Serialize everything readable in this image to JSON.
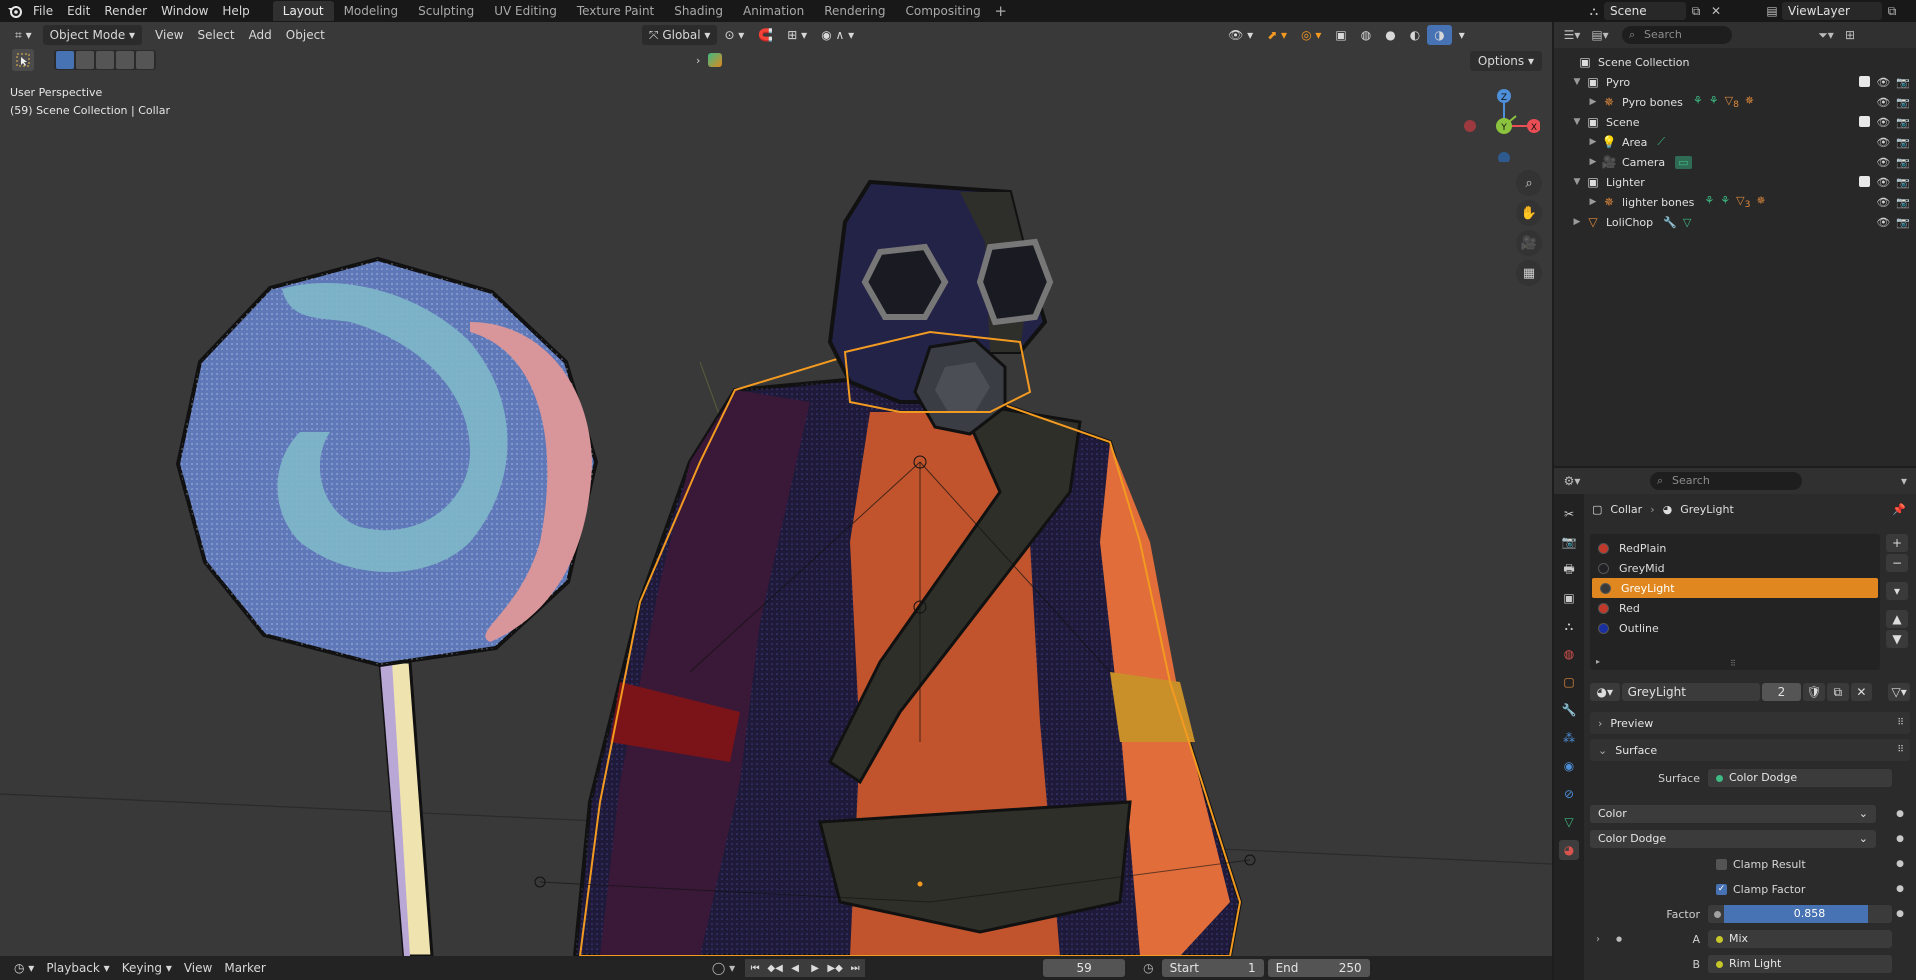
{
  "menu": {
    "items": [
      "File",
      "Edit",
      "Render",
      "Window",
      "Help"
    ],
    "workspaces": [
      "Layout",
      "Modeling",
      "Sculpting",
      "UV Editing",
      "Texture Paint",
      "Shading",
      "Animation",
      "Rendering",
      "Compositing"
    ],
    "active_workspace": "Layout",
    "scene_name": "Scene",
    "view_layer": "ViewLayer"
  },
  "viewport": {
    "mode": "Object Mode",
    "menus": [
      "View",
      "Select",
      "Add",
      "Object"
    ],
    "transform_orientation": "Global",
    "options_label": "Options",
    "info_line1": "User Perspective",
    "info_line2": "(59) Scene Collection | Collar",
    "gizmo": {
      "x": "X",
      "y": "Y",
      "z": "Z"
    },
    "colors": {
      "bg": "#393939",
      "x_axis": "#e94e55",
      "y_axis": "#8bc33f",
      "z_axis": "#4d8fd8",
      "selection": "#f39a21"
    }
  },
  "timeline": {
    "menus": [
      "Playback",
      "Keying",
      "View",
      "Marker"
    ],
    "current_frame": "59",
    "start_label": "Start",
    "start": "1",
    "end_label": "End",
    "end": "250"
  },
  "outliner": {
    "search_placeholder": "Search",
    "root": "Scene Collection",
    "rows": [
      {
        "label": "Pyro",
        "type": "collection"
      },
      {
        "label": "Pyro bones",
        "type": "armature"
      },
      {
        "label": "Scene",
        "type": "collection"
      },
      {
        "label": "Area",
        "type": "light"
      },
      {
        "label": "Camera",
        "type": "camera"
      },
      {
        "label": "Lighter",
        "type": "collection"
      },
      {
        "label": "lighter bones",
        "type": "armature"
      },
      {
        "label": "LoliChop",
        "type": "mesh"
      }
    ],
    "badges": {
      "pyro": "8",
      "lighter": "3"
    }
  },
  "properties": {
    "search_placeholder": "Search",
    "breadcrumb_object": "Collar",
    "breadcrumb_material": "GreyLight",
    "materials": [
      {
        "name": "RedPlain",
        "color": "#c0392b"
      },
      {
        "name": "GreyMid",
        "color": "#222226"
      },
      {
        "name": "GreyLight",
        "color": "#3a3a3a"
      },
      {
        "name": "Red",
        "color": "#c0392b"
      },
      {
        "name": "Outline",
        "color": "#1a2fa0"
      }
    ],
    "active_material": "GreyLight",
    "material_field": "GreyLight",
    "user_count": "2",
    "panel_preview": "Preview",
    "panel_surface": "Surface",
    "surface_label": "Surface",
    "surface_value": "Color Dodge",
    "data_type": "Color",
    "blend_type": "Color Dodge",
    "clamp_result": "Clamp Result",
    "clamp_factor": "Clamp Factor",
    "factor_label": "Factor",
    "factor_value": "0.858",
    "factor": 0.858,
    "a_label": "A",
    "a_value": "Mix",
    "b_label": "B",
    "b_value": "Rim Light"
  }
}
